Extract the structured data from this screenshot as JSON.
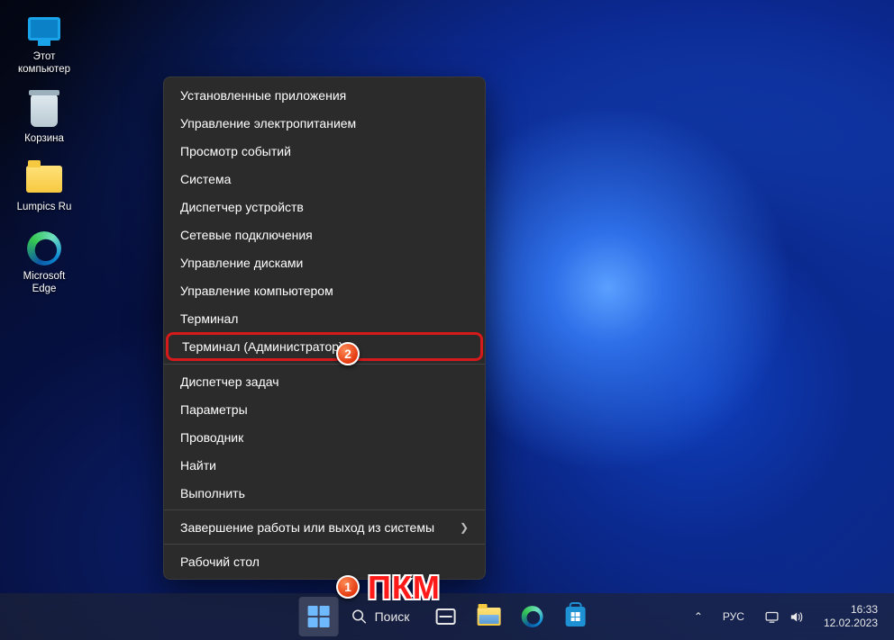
{
  "desktop": {
    "icons": [
      {
        "id": "this-pc",
        "label": "Этот\nкомпьютер"
      },
      {
        "id": "recycle",
        "label": "Корзина"
      },
      {
        "id": "lumpics",
        "label": "Lumpics Ru"
      },
      {
        "id": "edge",
        "label": "Microsoft\nEdge"
      }
    ]
  },
  "winx_menu": {
    "items": [
      "Установленные приложения",
      "Управление электропитанием",
      "Просмотр событий",
      "Система",
      "Диспетчер устройств",
      "Сетевые подключения",
      "Управление дисками",
      "Управление компьютером",
      "Терминал",
      "Терминал (Администратор)",
      "Диспетчер задач",
      "Параметры",
      "Проводник",
      "Найти",
      "Выполнить",
      "Завершение работы или выход из системы",
      "Рабочий стол"
    ],
    "highlighted_index": 9,
    "submenu_index": 15
  },
  "annotations": {
    "badge1": "1",
    "badge2": "2",
    "rmb_text": "ПКМ"
  },
  "taskbar": {
    "search_label": "Поиск"
  },
  "tray": {
    "lang": "РУС",
    "time": "16:33",
    "date": "12.02.2023",
    "chevron": "⌃"
  }
}
